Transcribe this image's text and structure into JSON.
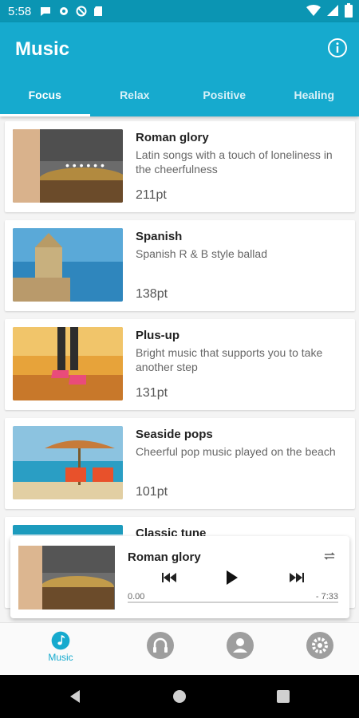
{
  "status_bar": {
    "time": "5:58"
  },
  "app": {
    "title": "Music"
  },
  "tabs": [
    {
      "label": "Focus",
      "active": true
    },
    {
      "label": "Relax"
    },
    {
      "label": "Positive"
    },
    {
      "label": "Healing"
    }
  ],
  "tracks": [
    {
      "title": "Roman glory",
      "description": "Latin songs with a touch of loneliness in the cheerfulness",
      "points": "211pt"
    },
    {
      "title": "Spanish",
      "description": "Spanish R & B style ballad",
      "points": "138pt"
    },
    {
      "title": "Plus-up",
      "description": "Bright music that supports you to take another step",
      "points": "131pt"
    },
    {
      "title": "Seaside pops",
      "description": "Cheerful pop music played on the beach",
      "points": "101pt"
    },
    {
      "title": "Classic tune",
      "description": "",
      "points": ""
    }
  ],
  "player": {
    "title": "Roman glory",
    "time_elapsed": "0.00",
    "time_remaining": "- 7:33",
    "progress": 0
  },
  "bottom_nav": {
    "music_label": "Music"
  },
  "colors": {
    "accent": "#16aace",
    "status_bar": "#0b95b3"
  },
  "icons": [
    "info-icon",
    "music-note-icon",
    "headphones-icon",
    "person-icon",
    "gear-icon",
    "repeat-icon",
    "skip-previous-icon",
    "play-icon",
    "skip-next-icon"
  ]
}
